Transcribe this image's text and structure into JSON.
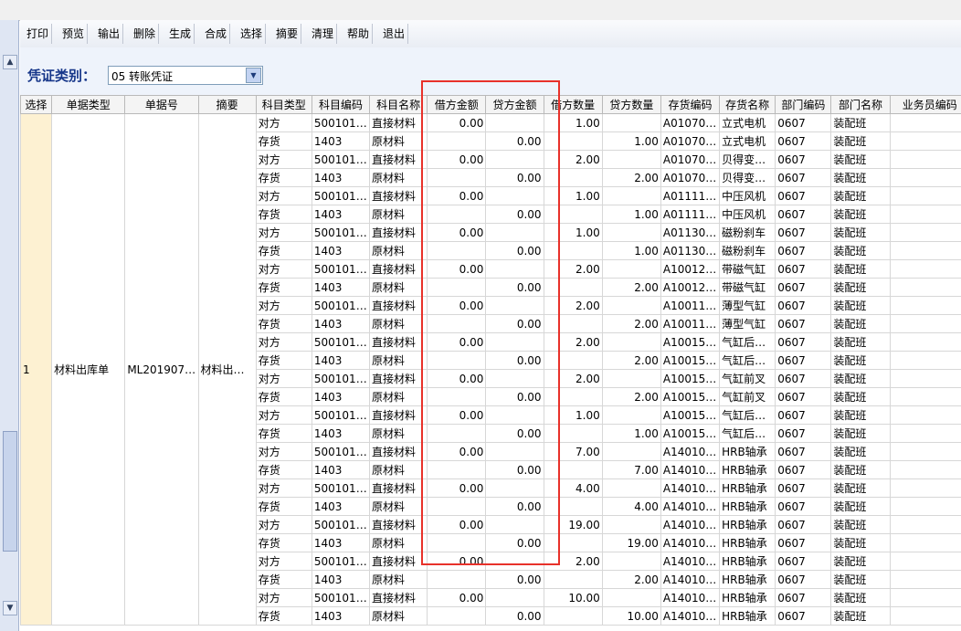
{
  "toolbar": [
    "打印",
    "预览",
    "输出",
    "删除",
    "生成",
    "合成",
    "选择",
    "摘要",
    "清理",
    "帮助",
    "退出"
  ],
  "voucher": {
    "label": "凭证类别：",
    "value": "05 转账凭证"
  },
  "columns": [
    "选择",
    "单据类型",
    "单据号",
    "摘要",
    "科目类型",
    "科目编码",
    "科目名称",
    "借方金额",
    "贷方金额",
    "借方数量",
    "贷方数量",
    "存货编码",
    "存货名称",
    "部门编码",
    "部门名称",
    "业务员编码"
  ],
  "group": {
    "select": "1",
    "doc_type": "材料出库单",
    "doc_no": "ML20190701...",
    "summary": "材料出库..."
  },
  "rows": [
    [
      "对方",
      "50010101",
      "直接材料",
      "0.00",
      "",
      "1.00",
      "",
      "A0107040...",
      "立式电机",
      "0607",
      "装配班",
      ""
    ],
    [
      "存货",
      "1403",
      "原材料",
      "",
      "0.00",
      "",
      "1.00",
      "A0107040...",
      "立式电机",
      "0607",
      "装配班",
      ""
    ],
    [
      "对方",
      "50010101",
      "直接材料",
      "0.00",
      "",
      "2.00",
      "",
      "A0107080...",
      "贝得变频...",
      "0607",
      "装配班",
      ""
    ],
    [
      "存货",
      "1403",
      "原材料",
      "",
      "0.00",
      "",
      "2.00",
      "A0107080...",
      "贝得变频...",
      "0607",
      "装配班",
      ""
    ],
    [
      "对方",
      "50010101",
      "直接材料",
      "0.00",
      "",
      "1.00",
      "",
      "A0111130...",
      "中压风机",
      "0607",
      "装配班",
      ""
    ],
    [
      "存货",
      "1403",
      "原材料",
      "",
      "0.00",
      "",
      "1.00",
      "A0111130...",
      "中压风机",
      "0607",
      "装配班",
      ""
    ],
    [
      "对方",
      "50010101",
      "直接材料",
      "0.00",
      "",
      "1.00",
      "",
      "A0113020...",
      "磁粉刹车",
      "0607",
      "装配班",
      ""
    ],
    [
      "存货",
      "1403",
      "原材料",
      "",
      "0.00",
      "",
      "1.00",
      "A0113020...",
      "磁粉刹车",
      "0607",
      "装配班",
      ""
    ],
    [
      "对方",
      "50010101",
      "直接材料",
      "0.00",
      "",
      "2.00",
      "",
      "A1001210...",
      "带磁气缸",
      "0607",
      "装配班",
      ""
    ],
    [
      "存货",
      "1403",
      "原材料",
      "",
      "0.00",
      "",
      "2.00",
      "A1001210...",
      "带磁气缸",
      "0607",
      "装配班",
      ""
    ],
    [
      "对方",
      "50010101",
      "直接材料",
      "0.00",
      "",
      "2.00",
      "",
      "A1001140...",
      "薄型气缸",
      "0607",
      "装配班",
      ""
    ],
    [
      "存货",
      "1403",
      "原材料",
      "",
      "0.00",
      "",
      "2.00",
      "A1001140...",
      "薄型气缸",
      "0607",
      "装配班",
      ""
    ],
    [
      "对方",
      "50010101",
      "直接材料",
      "0.00",
      "",
      "2.00",
      "",
      "A1001510...",
      "气缸后单...",
      "0607",
      "装配班",
      ""
    ],
    [
      "存货",
      "1403",
      "原材料",
      "",
      "0.00",
      "",
      "2.00",
      "A1001510...",
      "气缸后单...",
      "0607",
      "装配班",
      ""
    ],
    [
      "对方",
      "50010101",
      "直接材料",
      "0.00",
      "",
      "2.00",
      "",
      "A1001530...",
      "气缸前叉",
      "0607",
      "装配班",
      ""
    ],
    [
      "存货",
      "1403",
      "原材料",
      "",
      "0.00",
      "",
      "2.00",
      "A1001530...",
      "气缸前叉",
      "0607",
      "装配班",
      ""
    ],
    [
      "对方",
      "50010101",
      "直接材料",
      "0.00",
      "",
      "1.00",
      "",
      "A1001510...",
      "气缸后单...",
      "0607",
      "装配班",
      ""
    ],
    [
      "存货",
      "1403",
      "原材料",
      "",
      "0.00",
      "",
      "1.00",
      "A1001510...",
      "气缸后单...",
      "0607",
      "装配班",
      ""
    ],
    [
      "对方",
      "50010101",
      "直接材料",
      "0.00",
      "",
      "7.00",
      "",
      "A1401020...",
      "HRB轴承",
      "0607",
      "装配班",
      ""
    ],
    [
      "存货",
      "1403",
      "原材料",
      "",
      "0.00",
      "",
      "7.00",
      "A1401020...",
      "HRB轴承",
      "0607",
      "装配班",
      ""
    ],
    [
      "对方",
      "50010101",
      "直接材料",
      "0.00",
      "",
      "4.00",
      "",
      "A1401020...",
      "HRB轴承",
      "0607",
      "装配班",
      ""
    ],
    [
      "存货",
      "1403",
      "原材料",
      "",
      "0.00",
      "",
      "4.00",
      "A1401020...",
      "HRB轴承",
      "0607",
      "装配班",
      ""
    ],
    [
      "对方",
      "50010101",
      "直接材料",
      "0.00",
      "",
      "19.00",
      "",
      "A1401020...",
      "HRB轴承",
      "0607",
      "装配班",
      ""
    ],
    [
      "存货",
      "1403",
      "原材料",
      "",
      "0.00",
      "",
      "19.00",
      "A1401020...",
      "HRB轴承",
      "0607",
      "装配班",
      ""
    ],
    [
      "对方",
      "50010101",
      "直接材料",
      "0.00",
      "",
      "2.00",
      "",
      "A1401020...",
      "HRB轴承",
      "0607",
      "装配班",
      ""
    ],
    [
      "存货",
      "1403",
      "原材料",
      "",
      "0.00",
      "",
      "2.00",
      "A1401020...",
      "HRB轴承",
      "0607",
      "装配班",
      ""
    ],
    [
      "对方",
      "50010101",
      "直接材料",
      "0.00",
      "",
      "10.00",
      "",
      "A1401020...",
      "HRB轴承",
      "0607",
      "装配班",
      ""
    ],
    [
      "存货",
      "1403",
      "原材料",
      "",
      "0.00",
      "",
      "10.00",
      "A1401020...",
      "HRB轴承",
      "0607",
      "装配班",
      ""
    ]
  ],
  "colors": {
    "highlight": "#e8312a",
    "select_cell": "#fdf1d2",
    "label": "#17378a"
  }
}
